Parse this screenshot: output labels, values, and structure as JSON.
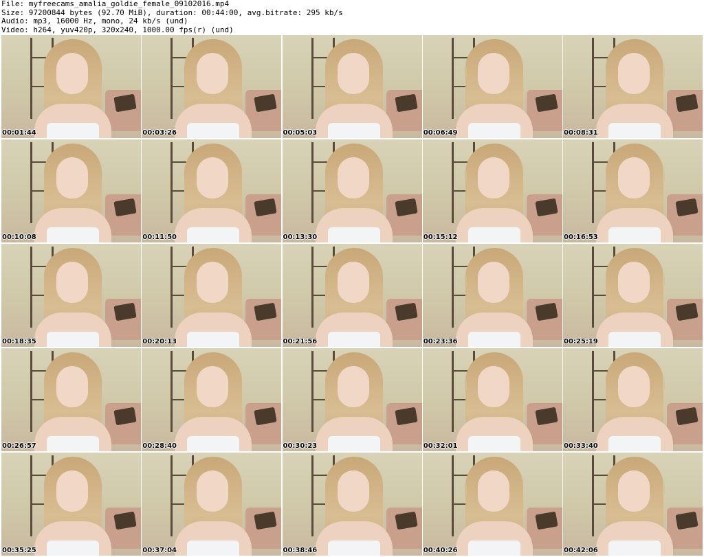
{
  "header": {
    "file": "File: myfreecams_amalia_goldie_female_09102016.mp4",
    "size": "Size: 97200844 bytes (92.70 MiB), duration: 00:44:00, avg.bitrate: 295 kb/s",
    "audio": "Audio: mp3, 16000 Hz, mono, 24 kb/s (und)",
    "video": "Video: h264, yuv420p, 320x240, 1000.00 fps(r) (und)"
  },
  "frames": [
    {
      "timestamp": "00:01:44"
    },
    {
      "timestamp": "00:03:26"
    },
    {
      "timestamp": "00:05:03"
    },
    {
      "timestamp": "00:06:49"
    },
    {
      "timestamp": "00:08:31"
    },
    {
      "timestamp": "00:10:08"
    },
    {
      "timestamp": "00:11:50"
    },
    {
      "timestamp": "00:13:30"
    },
    {
      "timestamp": "00:15:12"
    },
    {
      "timestamp": "00:16:53"
    },
    {
      "timestamp": "00:18:35"
    },
    {
      "timestamp": "00:20:13"
    },
    {
      "timestamp": "00:21:56"
    },
    {
      "timestamp": "00:23:36"
    },
    {
      "timestamp": "00:25:19"
    },
    {
      "timestamp": "00:26:57"
    },
    {
      "timestamp": "00:28:40"
    },
    {
      "timestamp": "00:30:23"
    },
    {
      "timestamp": "00:32:01"
    },
    {
      "timestamp": "00:33:40"
    },
    {
      "timestamp": "00:35:25"
    },
    {
      "timestamp": "00:37:04"
    },
    {
      "timestamp": "00:38:46"
    },
    {
      "timestamp": "00:40:26"
    },
    {
      "timestamp": "00:42:06"
    }
  ]
}
